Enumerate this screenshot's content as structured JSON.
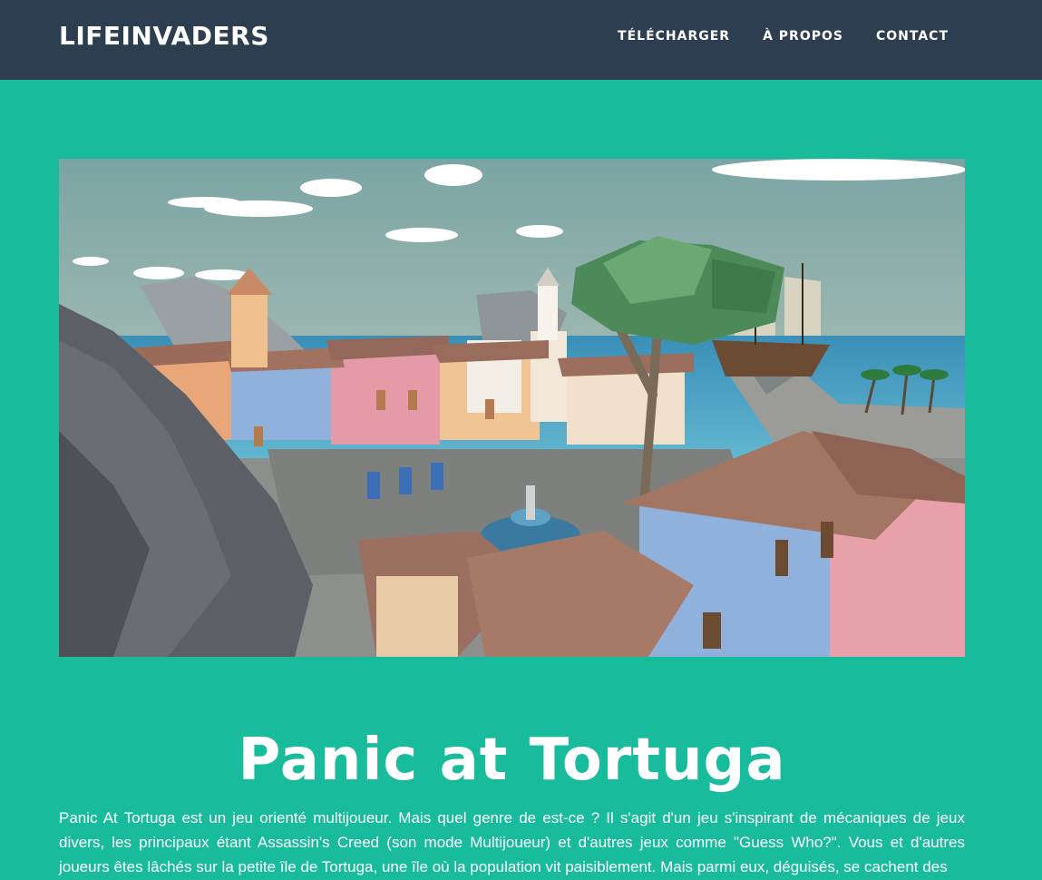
{
  "navbar": {
    "brand": "LIFEINVADERS",
    "links": [
      {
        "label": "TÉLÉCHARGER"
      },
      {
        "label": "À PROPOS"
      },
      {
        "label": "CONTACT"
      }
    ]
  },
  "main": {
    "hero_image": {
      "alt": "Panic at Tortuga"
    },
    "title": "Panic at Tortuga",
    "description": "Panic At Tortuga est un jeu orienté multijoueur. Mais quel genre de est-ce ? Il s'agit d'un jeu s'inspirant de mécaniques de jeux divers, les principaux étant Assassin's Creed (son mode Multijoueur) et d'autres jeux comme \"Guess Who?\". Vous et d'autres joueurs êtes lâchés sur la petite île de Tortuga, une île où la population vit paisiblement. Mais parmi eux, déguisés, se cachent des"
  },
  "colors": {
    "navbar_bg": "#2c3e50",
    "page_bg": "#18bc9c",
    "text": "#ffffff"
  }
}
